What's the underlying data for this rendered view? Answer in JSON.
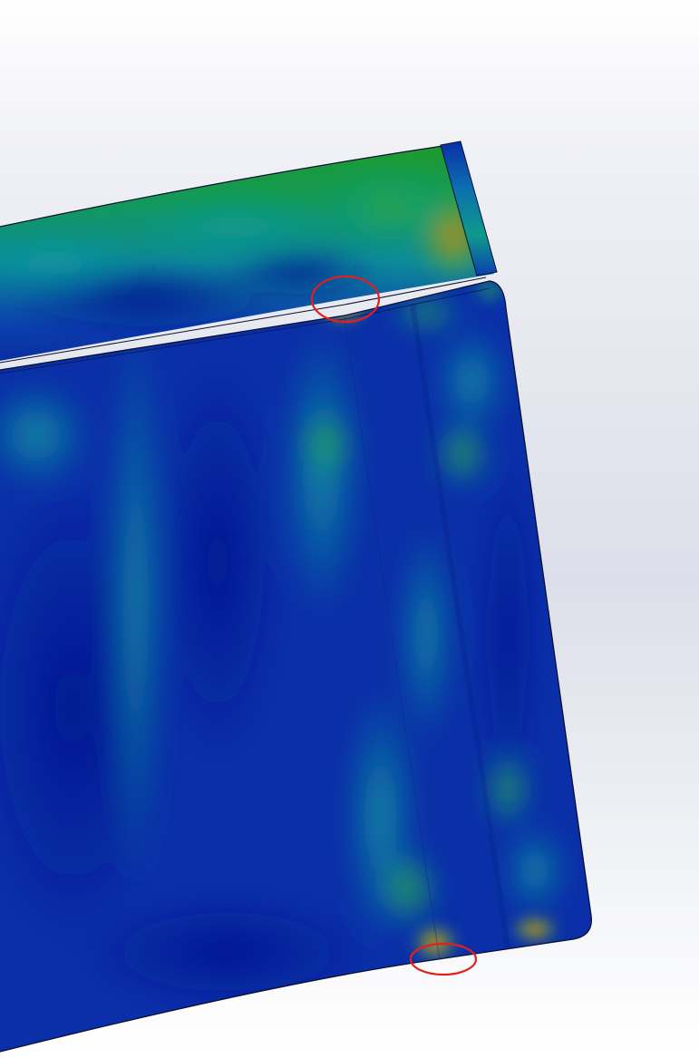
{
  "scene": {
    "background_top": "#e4e7ee",
    "background_bottom": "#ffffff",
    "colormap": [
      "#0a1fa0",
      "#0a3cb0",
      "#0e8ea0",
      "#12a040",
      "#8ab020",
      "#e08010",
      "#e04010"
    ],
    "highlight_color": "#e0201e"
  },
  "parts": {
    "upper_flange": "upper-flange-plate",
    "main_body": "main-body-plate",
    "side_lip": "side-lip"
  },
  "markers": [
    {
      "name": "stress-hotspot-top"
    },
    {
      "name": "stress-hotspot-bottom"
    }
  ]
}
